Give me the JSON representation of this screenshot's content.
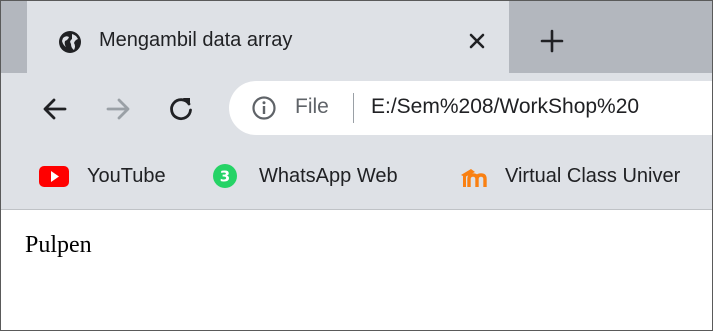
{
  "tab": {
    "title": "Mengambil data array",
    "favicon": "globe-icon",
    "close_icon": "close-icon"
  },
  "toolbar": {
    "back_icon": "arrow-left-icon",
    "forward_icon": "arrow-right-icon",
    "reload_icon": "reload-icon",
    "omnibox": {
      "info_icon": "info-icon",
      "scheme_label": "File",
      "url": "E:/Sem%208/WorkShop%20"
    }
  },
  "bookmarks": [
    {
      "label": "YouTube",
      "icon": "youtube-icon",
      "color": "#ff0000"
    },
    {
      "label": "WhatsApp Web",
      "icon": "whatsapp-icon",
      "color": "#25d366",
      "badge": "3"
    },
    {
      "label": "Virtual Class Univer",
      "icon": "moodle-icon",
      "color": "#f98012"
    }
  ],
  "page": {
    "text": "Pulpen"
  },
  "colors": {
    "tab_bg": "#dee1e6",
    "tabstrip_bg": "#b3b7be",
    "text": "#202124",
    "icon": "#202124"
  }
}
